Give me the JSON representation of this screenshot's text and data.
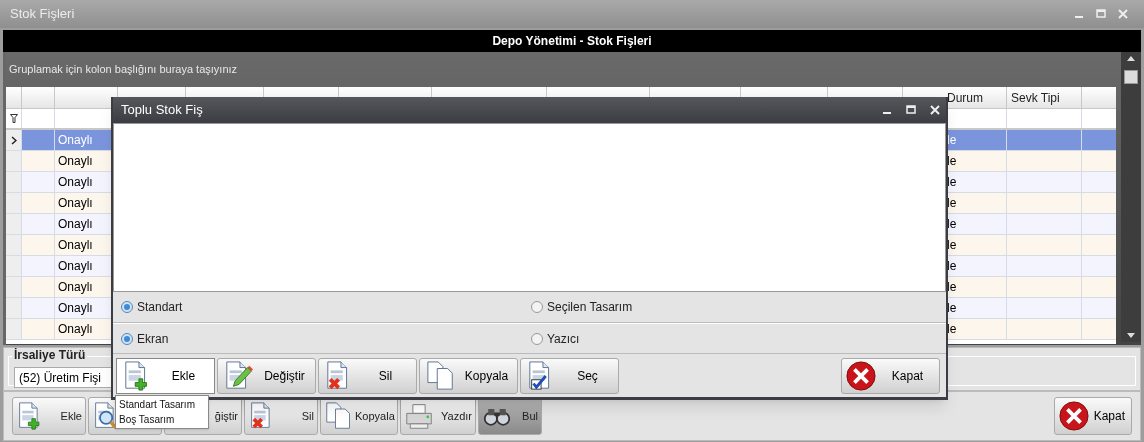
{
  "window": {
    "title": "Stok Fişleri"
  },
  "header": "Depo Yönetimi - Stok Fişleri",
  "group_panel": "Gruplamak için kolon başlığını buraya taşıyınız",
  "grid": {
    "columns": [
      "",
      "Durum",
      "Sevk Tipi"
    ],
    "rows": [
      {
        "selected": true,
        "cells": [
          "Onaylı",
          "le"
        ]
      },
      {
        "selected": false,
        "cells": [
          "Onaylı",
          "le"
        ]
      },
      {
        "selected": false,
        "cells": [
          "Onaylı",
          "le"
        ]
      },
      {
        "selected": false,
        "cells": [
          "Onaylı",
          "le"
        ]
      },
      {
        "selected": false,
        "cells": [
          "Onaylı",
          "le"
        ]
      },
      {
        "selected": false,
        "cells": [
          "Onaylı",
          "le"
        ]
      },
      {
        "selected": false,
        "cells": [
          "Onaylı",
          "le"
        ]
      },
      {
        "selected": false,
        "cells": [
          "Onaylı",
          "le"
        ]
      },
      {
        "selected": false,
        "cells": [
          "Onaylı",
          "le"
        ]
      },
      {
        "selected": false,
        "cells": [
          "Onaylı",
          "le"
        ]
      }
    ]
  },
  "irsaliye": {
    "label": "İrsaliye Türü",
    "value": "(52) Üretim Fişi"
  },
  "toolbar": [
    {
      "kind": "add",
      "label": "Ekle",
      "pressed": false
    },
    {
      "kind": "search",
      "pressed": false
    },
    {
      "label": "ğiştir",
      "pressed": false
    },
    {
      "kind": "delete",
      "label": "Sil",
      "pressed": false
    },
    {
      "kind": "copy",
      "label": "Kopyala",
      "pressed": false
    },
    {
      "kind": "print",
      "label": "Yazdır",
      "pressed": false
    },
    {
      "kind": "find",
      "label": "Bul",
      "pressed": true
    }
  ],
  "close_button": "Kapat",
  "dialog": {
    "title": "Toplu Stok Fiş",
    "option_rows": [
      [
        {
          "label": "Standart",
          "selected": true
        },
        {
          "label": "Seçilen Tasarım",
          "selected": false
        }
      ],
      [
        {
          "label": "Ekran",
          "selected": true
        },
        {
          "label": "Yazıcı",
          "selected": false
        }
      ]
    ],
    "buttons": [
      {
        "kind": "add",
        "label": "Ekle",
        "active": true
      },
      {
        "kind": "edit",
        "label": "Değiştir",
        "active": false
      },
      {
        "kind": "delete",
        "label": "Sil",
        "active": false
      },
      {
        "kind": "copy",
        "label": "Kopyala",
        "active": false
      },
      {
        "kind": "check",
        "label": "Seç",
        "active": false
      }
    ],
    "close_button": "Kapat"
  },
  "menu": [
    "Standart Tasarım",
    "Boş Tasarım"
  ]
}
